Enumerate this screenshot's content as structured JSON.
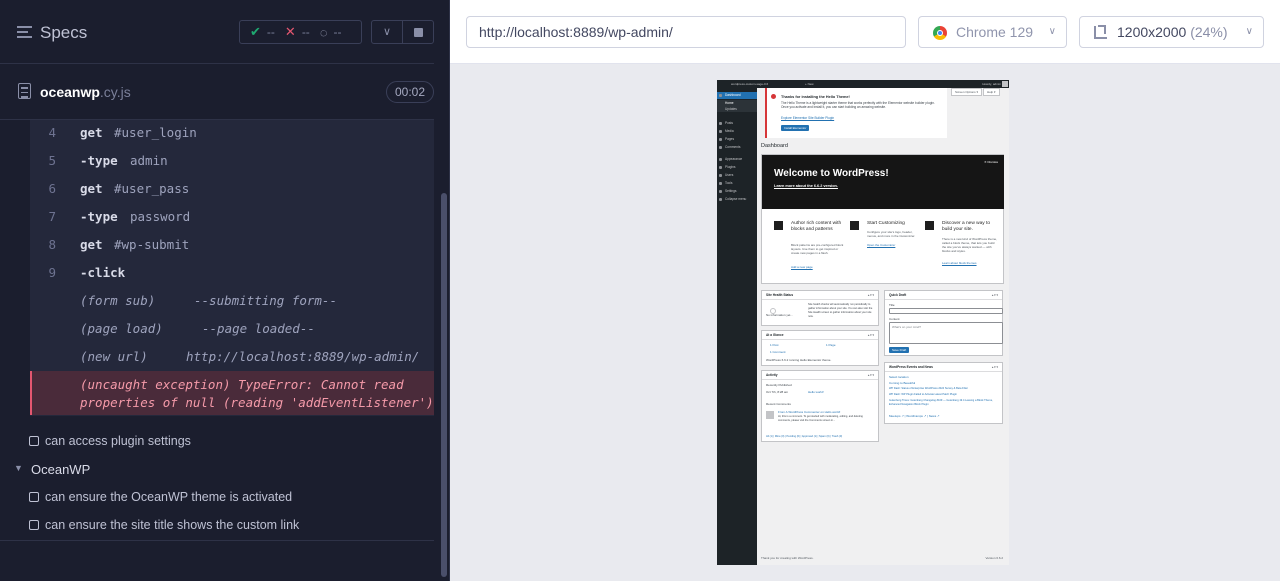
{
  "specs": {
    "title": "Specs",
    "stats": {
      "passed": "--",
      "failed": "--",
      "pending": "--"
    }
  },
  "file": {
    "name": "oceanwp",
    "ext": ".cy.js",
    "duration": "00:02"
  },
  "commands": [
    {
      "num": "4",
      "name": "get",
      "msg": "#user_login"
    },
    {
      "num": "5",
      "name": "-type",
      "msg": "admin"
    },
    {
      "num": "6",
      "name": "get",
      "msg": "#user_pass"
    },
    {
      "num": "7",
      "name": "-type",
      "msg": "password"
    },
    {
      "num": "8",
      "name": "get",
      "msg": "#wp-submit"
    },
    {
      "num": "9",
      "name": "-click",
      "msg": ""
    }
  ],
  "events": [
    {
      "label": "(form sub)",
      "msg": "--submitting form--"
    },
    {
      "label": "(page load)",
      "msg": "--page loaded--"
    },
    {
      "label": "(new url)",
      "msg": "http://localhost:8889/wp-admin/"
    }
  ],
  "error": {
    "line1": "(uncaught exception)  TypeError: Cannot read",
    "line2": "properties of null (reading 'addEventListener')"
  },
  "tests": [
    {
      "label": "can access plugin settings"
    },
    {
      "label": "can ensure the OceanWP theme is activated"
    },
    {
      "label": "can ensure the site title shows the custom link"
    }
  ],
  "suite": {
    "label": "OceanWP"
  },
  "topbar": {
    "url": "http://localhost:8889/wp-admin/",
    "browser": "Chrome 129",
    "viewport": "1200x2000",
    "zoom": "(24%)"
  },
  "wp": {
    "adminbar": {
      "site": "wordpress-custom-sage-0.6",
      "new": "+ New",
      "howdy": "Howdy, admin"
    },
    "menu": {
      "dashboard": "Dashboard",
      "home": "Home",
      "updates": "Updates",
      "posts": "Posts",
      "media": "Media",
      "pages": "Pages",
      "comments": "Comments",
      "appearance": "Appearance",
      "plugins": "Plugins",
      "users": "Users",
      "tools": "Tools",
      "settings": "Settings",
      "collapse": "Collapse menu"
    },
    "notice": {
      "title": "Thanks for installing the Hello Theme!",
      "desc": "The Hello Theme is a lightweight starter theme that works perfectly with the Elementor website builder plugin. Once you activate and install it, you can start building an amazing website.",
      "link": "Explore Elementor Site Builder Plugin",
      "button": "Install Elementor"
    },
    "tabs": {
      "screen": "Screen Options ▾",
      "help": "Help ▾"
    },
    "page_title": "Dashboard",
    "welcome": {
      "dismiss": "✕ Dismiss",
      "title": "Welcome to WordPress!",
      "link": "Learn more about the 6.6.2 version.",
      "col1": {
        "title": "Author rich content with blocks and patterns",
        "desc": "Block patterns are pre-configured block layouts. Use them to get inspired or create new pages in a flash.",
        "link": "Add a new page"
      },
      "col2": {
        "title": "Start Customizing",
        "desc": "Configure your site's logo, header, menus, and more in the Customizer.",
        "link": "Open the Customizer"
      },
      "col3": {
        "title": "Discover a new way to build your site.",
        "desc": "There is a new kind of WordPress theme, called a block theme, that lets you build the site you've always wanted — with blocks and styles.",
        "link": "Learn about block themes"
      }
    },
    "health": {
      "title": "Site Health Status",
      "status": "No information yet...",
      "desc": "Site health checks will automatically run periodically to gather information about your site. You can also visit the Site Health screen to gather information about your site now."
    },
    "glance": {
      "title": "At a Glance",
      "post": "1 Post",
      "page": "1 Page",
      "comment": "1 Comment",
      "desc": "WordPress 6.6.2 running Hello Elementor theme."
    },
    "activity": {
      "title": "Activity",
      "recent_pub": "Recently Published",
      "date": "Oct 7th, 8:28 am",
      "post": "Hello world!",
      "recent_com": "Recent Comments",
      "comment_from": "From A WordPress Commenter on Hello world!",
      "comment_text": "Hi, this is a comment. To get started with moderating, editing, and deleting comments, please visit the Comments screen in...",
      "filters": "All (1) | Mine (0) | Pending (0) | Approved (1) | Spam (0) | Trash (0)"
    },
    "draft": {
      "title": "Quick Draft",
      "title_label": "Title",
      "content_label": "Content",
      "content_placeholder": "What's on your mind?",
      "button": "Save Draft"
    },
    "events": {
      "title": "WordPress Events and News",
      "l1": "Select location",
      "l2": "Coming to Beautiful",
      "l3": "WP Dash: Status of Enterprise WordPress 2024 Survey & Beta Filter",
      "l4": "WP Dash: WP Plugin Failed to Activate Latest Patch Plugin",
      "l5": "Gutenberg Times: Gutenberg Changelog #109 — Gutenberg 19.4 Leaving a Block Theme, Enhanced Navigation Block Plugin",
      "l6": "Meetups ↗ | WordCamps ↗ | News ↗"
    },
    "footer": {
      "thanks": "Thank you for creating with WordPress.",
      "version": "Version 6.6.2"
    }
  }
}
